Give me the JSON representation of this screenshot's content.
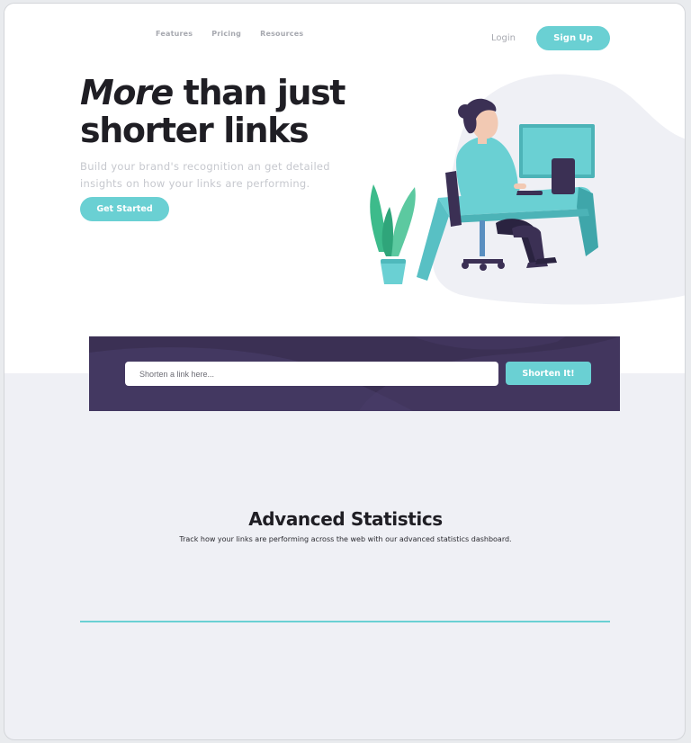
{
  "nav": {
    "links": [
      "Features",
      "Pricing",
      "Resources"
    ],
    "login": "Login",
    "signup": "Sign Up"
  },
  "hero": {
    "headline_italic": "More",
    "headline_rest": " than just shorter links",
    "subtitle": "Build your brand's recognition an get detailed insights on how your links are performing.",
    "cta": "Get Started",
    "illustration": "person-at-desk-illustration"
  },
  "shorten": {
    "placeholder": "Shorten a link here...",
    "button": "Shorten It!"
  },
  "stats": {
    "title": "Advanced Statistics",
    "subtitle": "Track how your links are performing across the web with our advanced statistics dashboard."
  },
  "colors": {
    "accent": "#6ad0d3",
    "dark_violet": "#3b3054",
    "text_dark": "#1f1e24",
    "text_gray": "#a7a9b0",
    "section_bg": "#eff0f5"
  }
}
